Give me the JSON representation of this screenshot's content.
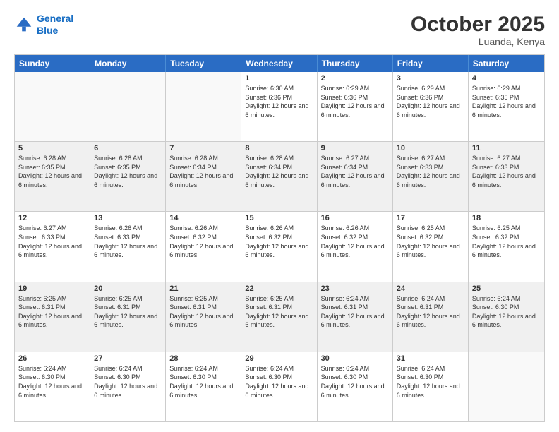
{
  "logo": {
    "line1": "General",
    "line2": "Blue"
  },
  "header": {
    "month_year": "October 2025",
    "location": "Luanda, Kenya"
  },
  "weekdays": [
    "Sunday",
    "Monday",
    "Tuesday",
    "Wednesday",
    "Thursday",
    "Friday",
    "Saturday"
  ],
  "weeks": [
    [
      {
        "day": "",
        "sunrise": "",
        "sunset": "",
        "daylight": "",
        "empty": true
      },
      {
        "day": "",
        "sunrise": "",
        "sunset": "",
        "daylight": "",
        "empty": true
      },
      {
        "day": "",
        "sunrise": "",
        "sunset": "",
        "daylight": "",
        "empty": true
      },
      {
        "day": "1",
        "sunrise": "Sunrise: 6:30 AM",
        "sunset": "Sunset: 6:36 PM",
        "daylight": "Daylight: 12 hours and 6 minutes.",
        "empty": false
      },
      {
        "day": "2",
        "sunrise": "Sunrise: 6:29 AM",
        "sunset": "Sunset: 6:36 PM",
        "daylight": "Daylight: 12 hours and 6 minutes.",
        "empty": false
      },
      {
        "day": "3",
        "sunrise": "Sunrise: 6:29 AM",
        "sunset": "Sunset: 6:36 PM",
        "daylight": "Daylight: 12 hours and 6 minutes.",
        "empty": false
      },
      {
        "day": "4",
        "sunrise": "Sunrise: 6:29 AM",
        "sunset": "Sunset: 6:35 PM",
        "daylight": "Daylight: 12 hours and 6 minutes.",
        "empty": false
      }
    ],
    [
      {
        "day": "5",
        "sunrise": "Sunrise: 6:28 AM",
        "sunset": "Sunset: 6:35 PM",
        "daylight": "Daylight: 12 hours and 6 minutes.",
        "empty": false
      },
      {
        "day": "6",
        "sunrise": "Sunrise: 6:28 AM",
        "sunset": "Sunset: 6:35 PM",
        "daylight": "Daylight: 12 hours and 6 minutes.",
        "empty": false
      },
      {
        "day": "7",
        "sunrise": "Sunrise: 6:28 AM",
        "sunset": "Sunset: 6:34 PM",
        "daylight": "Daylight: 12 hours and 6 minutes.",
        "empty": false
      },
      {
        "day": "8",
        "sunrise": "Sunrise: 6:28 AM",
        "sunset": "Sunset: 6:34 PM",
        "daylight": "Daylight: 12 hours and 6 minutes.",
        "empty": false
      },
      {
        "day": "9",
        "sunrise": "Sunrise: 6:27 AM",
        "sunset": "Sunset: 6:34 PM",
        "daylight": "Daylight: 12 hours and 6 minutes.",
        "empty": false
      },
      {
        "day": "10",
        "sunrise": "Sunrise: 6:27 AM",
        "sunset": "Sunset: 6:33 PM",
        "daylight": "Daylight: 12 hours and 6 minutes.",
        "empty": false
      },
      {
        "day": "11",
        "sunrise": "Sunrise: 6:27 AM",
        "sunset": "Sunset: 6:33 PM",
        "daylight": "Daylight: 12 hours and 6 minutes.",
        "empty": false
      }
    ],
    [
      {
        "day": "12",
        "sunrise": "Sunrise: 6:27 AM",
        "sunset": "Sunset: 6:33 PM",
        "daylight": "Daylight: 12 hours and 6 minutes.",
        "empty": false
      },
      {
        "day": "13",
        "sunrise": "Sunrise: 6:26 AM",
        "sunset": "Sunset: 6:33 PM",
        "daylight": "Daylight: 12 hours and 6 minutes.",
        "empty": false
      },
      {
        "day": "14",
        "sunrise": "Sunrise: 6:26 AM",
        "sunset": "Sunset: 6:32 PM",
        "daylight": "Daylight: 12 hours and 6 minutes.",
        "empty": false
      },
      {
        "day": "15",
        "sunrise": "Sunrise: 6:26 AM",
        "sunset": "Sunset: 6:32 PM",
        "daylight": "Daylight: 12 hours and 6 minutes.",
        "empty": false
      },
      {
        "day": "16",
        "sunrise": "Sunrise: 6:26 AM",
        "sunset": "Sunset: 6:32 PM",
        "daylight": "Daylight: 12 hours and 6 minutes.",
        "empty": false
      },
      {
        "day": "17",
        "sunrise": "Sunrise: 6:25 AM",
        "sunset": "Sunset: 6:32 PM",
        "daylight": "Daylight: 12 hours and 6 minutes.",
        "empty": false
      },
      {
        "day": "18",
        "sunrise": "Sunrise: 6:25 AM",
        "sunset": "Sunset: 6:32 PM",
        "daylight": "Daylight: 12 hours and 6 minutes.",
        "empty": false
      }
    ],
    [
      {
        "day": "19",
        "sunrise": "Sunrise: 6:25 AM",
        "sunset": "Sunset: 6:31 PM",
        "daylight": "Daylight: 12 hours and 6 minutes.",
        "empty": false
      },
      {
        "day": "20",
        "sunrise": "Sunrise: 6:25 AM",
        "sunset": "Sunset: 6:31 PM",
        "daylight": "Daylight: 12 hours and 6 minutes.",
        "empty": false
      },
      {
        "day": "21",
        "sunrise": "Sunrise: 6:25 AM",
        "sunset": "Sunset: 6:31 PM",
        "daylight": "Daylight: 12 hours and 6 minutes.",
        "empty": false
      },
      {
        "day": "22",
        "sunrise": "Sunrise: 6:25 AM",
        "sunset": "Sunset: 6:31 PM",
        "daylight": "Daylight: 12 hours and 6 minutes.",
        "empty": false
      },
      {
        "day": "23",
        "sunrise": "Sunrise: 6:24 AM",
        "sunset": "Sunset: 6:31 PM",
        "daylight": "Daylight: 12 hours and 6 minutes.",
        "empty": false
      },
      {
        "day": "24",
        "sunrise": "Sunrise: 6:24 AM",
        "sunset": "Sunset: 6:31 PM",
        "daylight": "Daylight: 12 hours and 6 minutes.",
        "empty": false
      },
      {
        "day": "25",
        "sunrise": "Sunrise: 6:24 AM",
        "sunset": "Sunset: 6:30 PM",
        "daylight": "Daylight: 12 hours and 6 minutes.",
        "empty": false
      }
    ],
    [
      {
        "day": "26",
        "sunrise": "Sunrise: 6:24 AM",
        "sunset": "Sunset: 6:30 PM",
        "daylight": "Daylight: 12 hours and 6 minutes.",
        "empty": false
      },
      {
        "day": "27",
        "sunrise": "Sunrise: 6:24 AM",
        "sunset": "Sunset: 6:30 PM",
        "daylight": "Daylight: 12 hours and 6 minutes.",
        "empty": false
      },
      {
        "day": "28",
        "sunrise": "Sunrise: 6:24 AM",
        "sunset": "Sunset: 6:30 PM",
        "daylight": "Daylight: 12 hours and 6 minutes.",
        "empty": false
      },
      {
        "day": "29",
        "sunrise": "Sunrise: 6:24 AM",
        "sunset": "Sunset: 6:30 PM",
        "daylight": "Daylight: 12 hours and 6 minutes.",
        "empty": false
      },
      {
        "day": "30",
        "sunrise": "Sunrise: 6:24 AM",
        "sunset": "Sunset: 6:30 PM",
        "daylight": "Daylight: 12 hours and 6 minutes.",
        "empty": false
      },
      {
        "day": "31",
        "sunrise": "Sunrise: 6:24 AM",
        "sunset": "Sunset: 6:30 PM",
        "daylight": "Daylight: 12 hours and 6 minutes.",
        "empty": false
      },
      {
        "day": "",
        "sunrise": "",
        "sunset": "",
        "daylight": "",
        "empty": true
      }
    ]
  ]
}
